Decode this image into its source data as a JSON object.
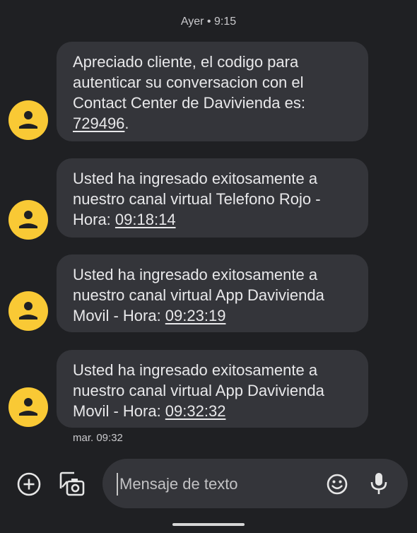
{
  "date_header": "Ayer • 9:15",
  "messages": [
    {
      "lines": [
        "Apreciado cliente, el codigo para",
        "autenticar su conversacion con el",
        "Contact Center de Davivienda es:"
      ],
      "code": "729496",
      "suffix": "."
    },
    {
      "lines": [
        "Usted ha ingresado exitosamente a",
        "nuestro canal virtual Telefono Rojo -"
      ],
      "prefix": "Hora: ",
      "code": "09:18:14"
    },
    {
      "lines": [
        "Usted ha ingresado exitosamente a",
        "nuestro canal virtual App Davivienda"
      ],
      "prefix": "Movil - Hora: ",
      "code": "09:23:19"
    },
    {
      "lines": [
        "Usted ha ingresado exitosamente a",
        "nuestro canal virtual App Davivienda"
      ],
      "prefix": "Movil - Hora: ",
      "code": "09:32:32"
    }
  ],
  "time_footer": "mar. 09:32",
  "composer": {
    "placeholder": "Mensaje de texto"
  },
  "icons": {
    "avatar": "person-icon",
    "add": "add-circle-icon",
    "gallery": "gallery-camera-icon",
    "emoji": "emoji-icon",
    "mic": "microphone-icon"
  },
  "colors": {
    "background": "#1f2023",
    "bubble": "#34353a",
    "avatar": "#f9c935"
  }
}
